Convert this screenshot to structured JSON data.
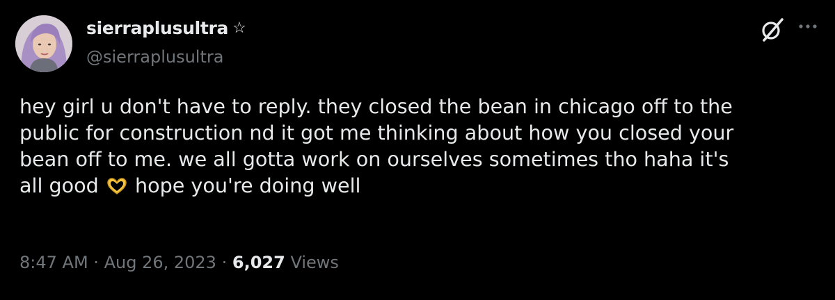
{
  "author": {
    "display_name": "sierraplusultra",
    "badge_icon": "star-outline-icon",
    "handle": "@sierraplusultra",
    "avatar_icon": "profile-photo"
  },
  "header_actions": {
    "grok_icon": "grok-icon",
    "more_icon": "more-dots-icon"
  },
  "tweet": {
    "lines": [
      "hey girl u don't have to reply. they closed the bean in chicago off to the",
      "public for construction nd it got me thinking about how you closed your",
      "bean off to me. we all gotta work on ourselves sometimes tho haha it's"
    ],
    "last_line_start": "all good",
    "emoji": "heart-hands-emoji",
    "last_line_end": "hope you're doing well"
  },
  "meta": {
    "time": "8:47 AM",
    "separator": "·",
    "date": "Aug 26, 2023",
    "views_count": "6,027",
    "views_label": "Views"
  },
  "colors": {
    "background": "#000000",
    "text_primary": "#e7e9ea",
    "text_secondary": "#71767b",
    "emoji_yellow": "#f5c542"
  }
}
